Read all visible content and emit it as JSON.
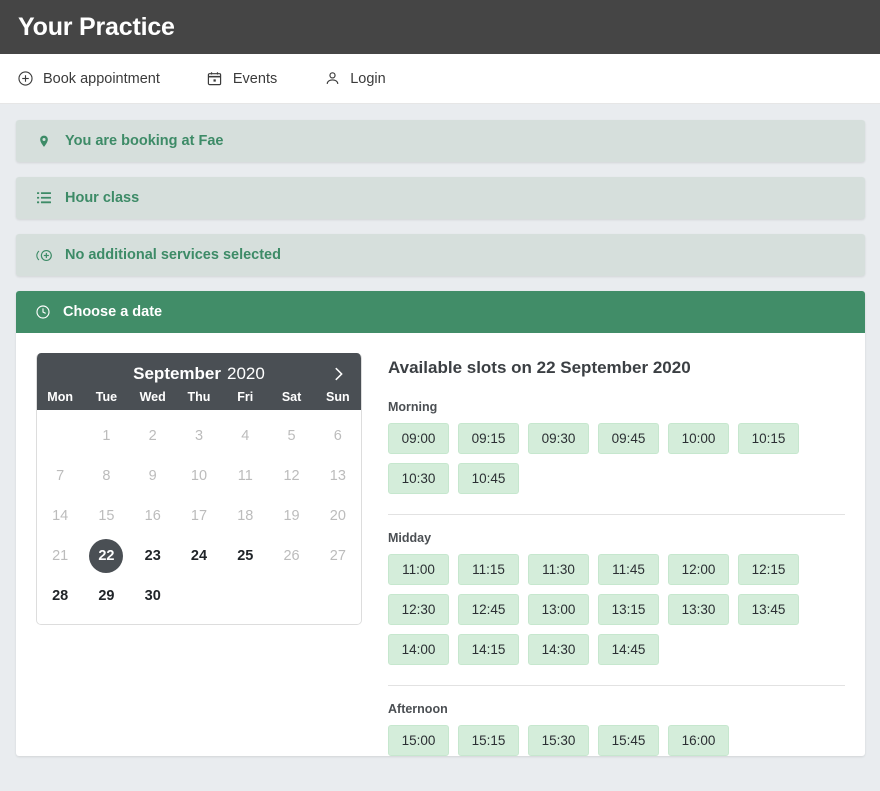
{
  "header": {
    "brand": "Your Practice"
  },
  "nav": {
    "items": [
      {
        "label": "Book appointment",
        "icon": "plus-circle-icon"
      },
      {
        "label": "Events",
        "icon": "calendar-icon"
      },
      {
        "label": "Login",
        "icon": "person-icon"
      }
    ]
  },
  "banners": [
    {
      "label": "You are booking at Fae",
      "icon": "map-pin-icon"
    },
    {
      "label": "Hour class",
      "icon": "list-icon"
    },
    {
      "label": "No additional services selected",
      "icon": "add-service-icon"
    }
  ],
  "panel": {
    "title": "Choose a date",
    "icon": "clock-icon"
  },
  "calendar": {
    "month": "September",
    "year": "2020",
    "next_label": "›",
    "weekdays": [
      "Mon",
      "Tue",
      "Wed",
      "Thu",
      "Fri",
      "Sat",
      "Sun"
    ],
    "leading_blanks": 1,
    "days": [
      {
        "n": "1",
        "state": "disabled"
      },
      {
        "n": "2",
        "state": "disabled"
      },
      {
        "n": "3",
        "state": "disabled"
      },
      {
        "n": "4",
        "state": "disabled"
      },
      {
        "n": "5",
        "state": "disabled"
      },
      {
        "n": "6",
        "state": "disabled"
      },
      {
        "n": "7",
        "state": "disabled"
      },
      {
        "n": "8",
        "state": "disabled"
      },
      {
        "n": "9",
        "state": "disabled"
      },
      {
        "n": "10",
        "state": "disabled"
      },
      {
        "n": "11",
        "state": "disabled"
      },
      {
        "n": "12",
        "state": "disabled"
      },
      {
        "n": "13",
        "state": "disabled"
      },
      {
        "n": "14",
        "state": "disabled"
      },
      {
        "n": "15",
        "state": "disabled"
      },
      {
        "n": "16",
        "state": "disabled"
      },
      {
        "n": "17",
        "state": "disabled"
      },
      {
        "n": "18",
        "state": "disabled"
      },
      {
        "n": "19",
        "state": "disabled"
      },
      {
        "n": "20",
        "state": "disabled"
      },
      {
        "n": "21",
        "state": "disabled"
      },
      {
        "n": "22",
        "state": "selected"
      },
      {
        "n": "23",
        "state": "enabled"
      },
      {
        "n": "24",
        "state": "enabled"
      },
      {
        "n": "25",
        "state": "enabled"
      },
      {
        "n": "26",
        "state": "disabled"
      },
      {
        "n": "27",
        "state": "disabled"
      },
      {
        "n": "28",
        "state": "enabled"
      },
      {
        "n": "29",
        "state": "enabled"
      },
      {
        "n": "30",
        "state": "enabled"
      }
    ]
  },
  "slots": {
    "title": "Available slots on 22 September 2020",
    "groups": [
      {
        "label": "Morning",
        "times": [
          "09:00",
          "09:15",
          "09:30",
          "09:45",
          "10:00",
          "10:15",
          "10:30",
          "10:45"
        ]
      },
      {
        "label": "Midday",
        "times": [
          "11:00",
          "11:15",
          "11:30",
          "11:45",
          "12:00",
          "12:15",
          "12:30",
          "12:45",
          "13:00",
          "13:15",
          "13:30",
          "13:45",
          "14:00",
          "14:15",
          "14:30",
          "14:45"
        ]
      },
      {
        "label": "Afternoon",
        "times": [
          "15:00",
          "15:15",
          "15:30",
          "15:45",
          "16:00"
        ]
      }
    ]
  },
  "colors": {
    "brand_green": "#418d68",
    "banner_bg": "#d6dfdc",
    "banner_text": "#3d8b67",
    "topbar": "#454545",
    "calendar_head": "#4a4f54",
    "slot_bg": "#d4edda",
    "page_bg": "#e9ecef"
  }
}
